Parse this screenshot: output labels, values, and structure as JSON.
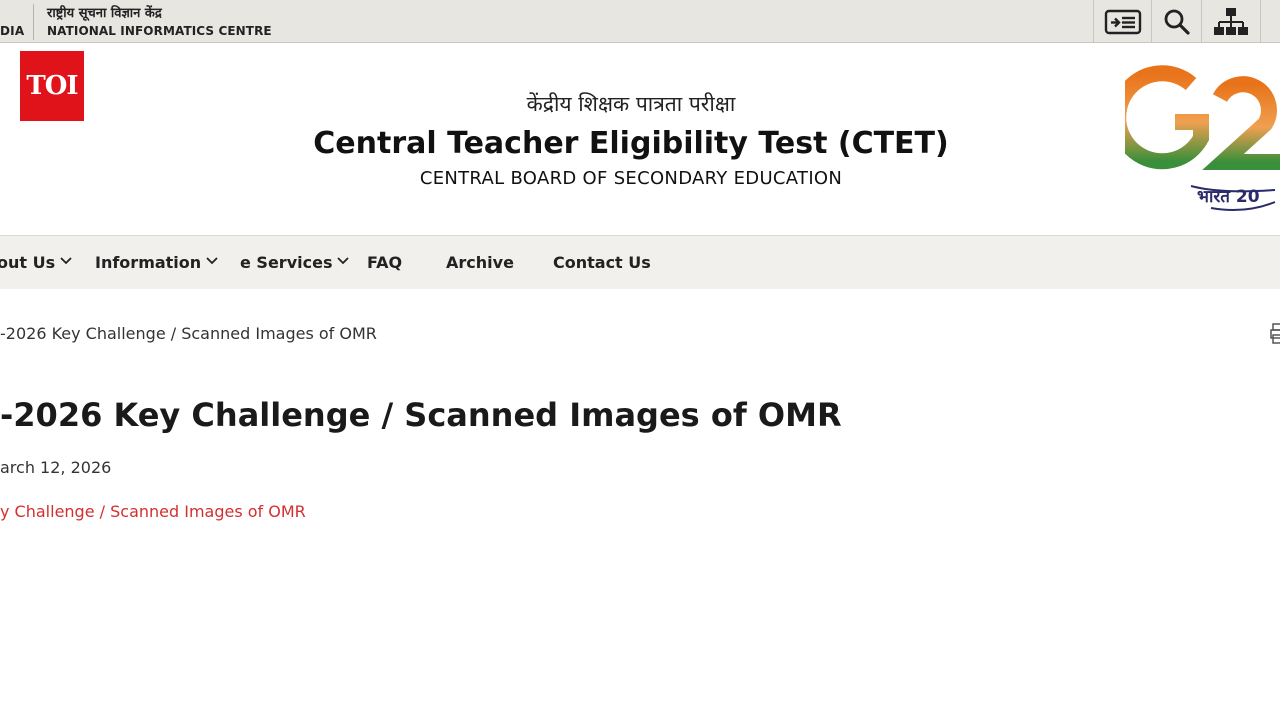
{
  "topbar": {
    "country": "DIA",
    "nic_hindi": "राष्ट्रीय सूचना विज्ञान केंद्र",
    "nic_english": "NATIONAL INFORMATICS CENTRE",
    "icons": [
      "skip-to-content-icon",
      "search-icon",
      "sitemap-icon"
    ]
  },
  "header": {
    "toi_logo": "TOI",
    "title_hindi": "केंद्रीय शिक्षक पात्रता परीक्षा",
    "title": "Central Teacher Eligibility Test (CTET)",
    "subtitle": "CENTRAL BOARD OF SECONDARY EDUCATION",
    "g20_logo_text": "G2",
    "g20_hindi": "भारत 20"
  },
  "nav": {
    "items": [
      {
        "label": "out Us",
        "has_dropdown": true
      },
      {
        "label": "Information",
        "has_dropdown": true
      },
      {
        "label": "e Services",
        "has_dropdown": true
      },
      {
        "label": "FAQ",
        "has_dropdown": false
      },
      {
        "label": "Archive",
        "has_dropdown": false
      },
      {
        "label": "Contact Us",
        "has_dropdown": false
      }
    ]
  },
  "breadcrumb": "-2026 Key Challenge / Scanned Images of OMR",
  "page": {
    "title": "-2026 Key Challenge / Scanned Images of OMR",
    "date": "arch 12, 2026",
    "link": "y Challenge / Scanned Images of OMR"
  },
  "colors": {
    "topbar_bg": "#e8e6e1",
    "nav_bg": "#f2f0ec",
    "toi_red": "#e0121a",
    "link_red": "#d32f2f",
    "g20_orange": "#e8731a",
    "g20_green": "#3a8f3a"
  }
}
